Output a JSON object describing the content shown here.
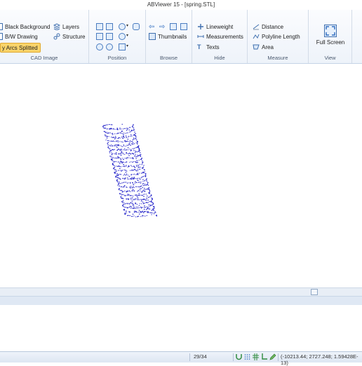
{
  "window": {
    "title": "ABViewer 15 - [spring.STL]"
  },
  "ribbon": {
    "cad_image": {
      "label": "CAD Image",
      "black_background": "Black Background",
      "bw_drawing": "B/W Drawing",
      "arcs_splitted": "y Arcs Splitted",
      "layers": "Layers",
      "structure": "Structure"
    },
    "position": {
      "label": "Position"
    },
    "browse": {
      "label": "Browse",
      "thumbnails": "Thumbnails"
    },
    "hide": {
      "label": "Hide",
      "lineweight": "Lineweight",
      "measurements": "Measurements",
      "texts": "Texts"
    },
    "measure": {
      "label": "Measure",
      "distance": "Distance",
      "polyline_length": "Polyline Length",
      "area": "Area"
    },
    "view": {
      "label": "View",
      "full_screen": "Full Screen"
    }
  },
  "status": {
    "page": "29/34",
    "coords": "(-10213.44; 2727.248; 1.59428E-13)"
  },
  "colors": {
    "spring": "#1f1fc8",
    "highlight": "#f9d46a"
  }
}
